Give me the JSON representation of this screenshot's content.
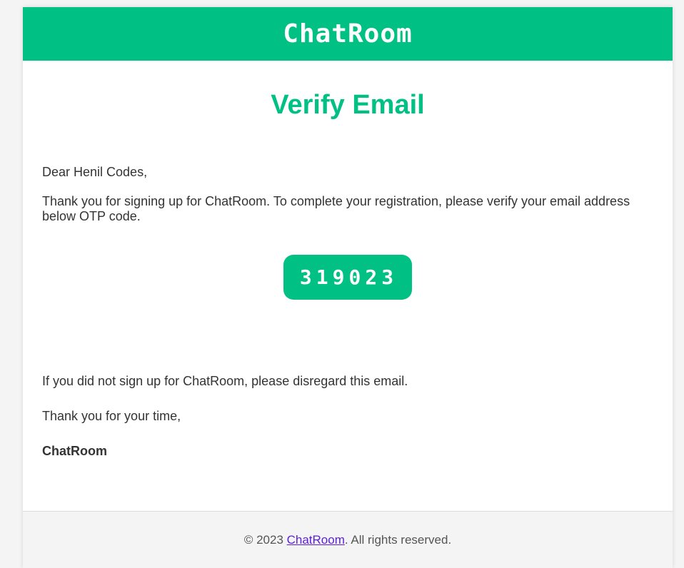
{
  "header": {
    "brand": "ChatRoom"
  },
  "main": {
    "title": "Verify Email",
    "greeting": "Dear Henil Codes,",
    "intro": "Thank you for signing up for ChatRoom. To complete your registration, please verify your email address below OTP code.",
    "otp_code": "319023",
    "disregard": "If you did not sign up for ChatRoom, please disregard this email.",
    "thanks": "Thank you for your time,",
    "signature": "ChatRoom"
  },
  "footer": {
    "prefix": "© 2023 ",
    "link_text": "ChatRoom",
    "suffix": ". All rights reserved."
  },
  "colors": {
    "brand_green": "#00c083",
    "link_purple": "#5c1fd6",
    "background": "#f4f4f4"
  }
}
